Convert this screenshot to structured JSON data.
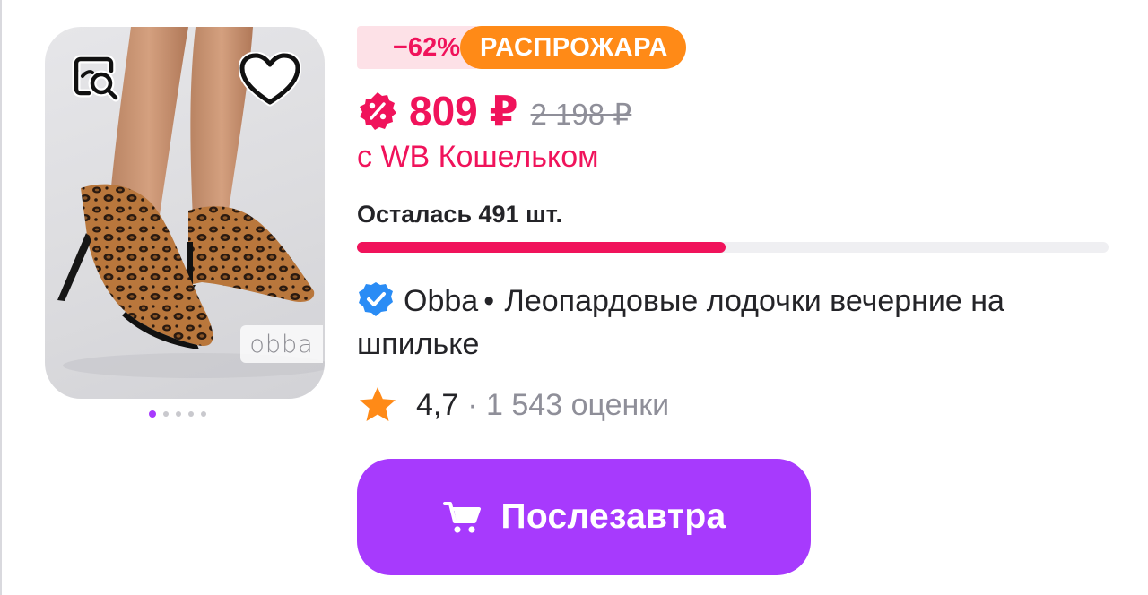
{
  "product": {
    "image": {
      "watermark": "obba",
      "slides": 5,
      "active_slide": 1,
      "find_similar_icon": "search-similar-icon",
      "wishlist_icon": "heart-icon"
    },
    "badge": {
      "discount": "−62%",
      "sale": "РАСПРОЖАРА"
    },
    "price": {
      "current": "809 ₽",
      "old": "2 198 ₽",
      "wallet_note": "с WB Кошельком",
      "icon": "discount-percent-icon"
    },
    "stock": {
      "label": "Осталась 491 шт.",
      "fill_fraction": 0.49
    },
    "title": {
      "brand": "Obba",
      "separator": "•",
      "name": "Леопардовые лодочки вечерние на шпильке",
      "verified_icon": "verified-check-icon"
    },
    "rating": {
      "value": "4,7",
      "separator": "·",
      "reviews": "1 543 оценки",
      "icon": "star-icon"
    },
    "cart_button": {
      "label": "Послезавтра",
      "icon": "cart-icon"
    }
  },
  "colors": {
    "accent_purple": "#a73afd",
    "price_red": "#f0135b",
    "sale_orange": "#ff8a17",
    "discount_bg": "#fde1e7",
    "star_orange": "#ff8a17",
    "muted_text": "#8f8f99",
    "verified_blue": "#2a8cf5"
  }
}
